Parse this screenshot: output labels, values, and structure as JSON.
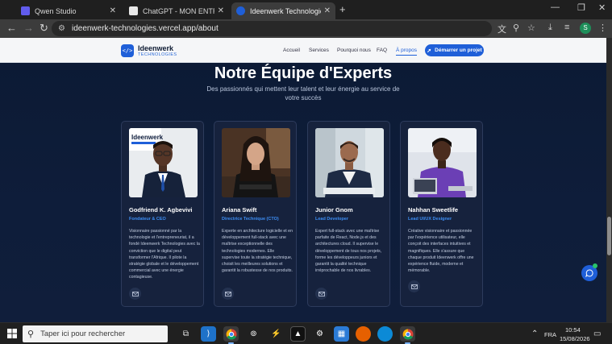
{
  "browser": {
    "tabs": [
      {
        "title": "Qwen Studio",
        "icon": "qwen-icon",
        "active": false
      },
      {
        "title": "ChatGPT - MON ENTREPRISE IDE",
        "icon": "chatgpt-icon",
        "active": false
      },
      {
        "title": "Ideenwerk Technologies - L'exce",
        "icon": "site-icon",
        "active": true
      }
    ],
    "new_tab": "+",
    "window_controls": {
      "minimize": "—",
      "maximize": "❐",
      "close": "✕"
    },
    "url": "ideenwerk-technologies.vercel.app/about",
    "profile_initial": "S"
  },
  "site": {
    "logo_mark": "</>",
    "logo_name": "Ideenwerk",
    "logo_sub": "TECHNOLOGIES",
    "menu": [
      {
        "label": "Accueil",
        "active": false
      },
      {
        "label": "Services",
        "active": false
      },
      {
        "label": "Pourquoi nous",
        "active": false
      },
      {
        "label": "FAQ",
        "active": false
      },
      {
        "label": "À propos",
        "active": true
      }
    ],
    "cta_label": "Démarrer un projet",
    "cta_icon": "rocket-icon",
    "accent_color": "#1f5fd8"
  },
  "team": {
    "title": "Notre Équipe d'Experts",
    "subtitle": "Des passionnés qui mettent leur talent et leur énergie au service de votre succès",
    "members": [
      {
        "name": "Godfriend K. Agbevivi",
        "role": "Fondateur & CEO",
        "bio": "Visionnaire passionné par la technologie et l'entrepreneuriat, il a fondé Ideenwerk Technologies avec la conviction que le digital peut transformer l'Afrique. Il pilote la stratégie globale et le développement commercial avec une énergie contagieuse.",
        "photo_banner": "Ideenwerk"
      },
      {
        "name": "Ariana Swift",
        "role": "Directrice Technique (CTO)",
        "bio": "Experte en architecture logicielle et en développement full-stack avec une maîtrise exceptionnelle des technologies modernes. Elle supervise toute la stratégie technique, choisit les meilleures solutions et garantit la robustesse de nos produits."
      },
      {
        "name": "Junior Gnom",
        "role": "Lead Developer",
        "bio": "Expert full-stack avec une maîtrise parfaite de React, Node.js et des architectures cloud. Il supervise le développement de tous nos projets, forme les développeurs juniors et garantit la qualité technique irréprochable de nos livrables."
      },
      {
        "name": "Nahhan Sweetlife",
        "role": "Lead UI/UX Designer",
        "bio": "Créative visionnaire et passionnée par l'expérience utilisateur, elle conçoit des interfaces intuitives et magnifiques. Elle s'assure que chaque produit Ideenwerk offre une expérience fluide, moderne et mémorable."
      }
    ]
  },
  "taskbar": {
    "search_placeholder": "Taper ici pour rechercher",
    "language": "FRA",
    "time": "10:54",
    "date": "15/08/2026"
  }
}
